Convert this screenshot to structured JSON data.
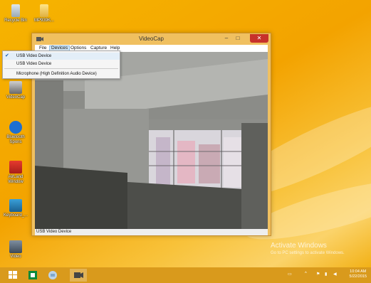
{
  "desktop": {
    "icons": [
      {
        "label": "Recycle Bin"
      },
      {
        "label": "MP939K..."
      },
      {
        "label": "VideoCap"
      },
      {
        "label": "Bluetooth Spons"
      },
      {
        "label": "AirLand Window"
      },
      {
        "label": "Keyboard_..."
      },
      {
        "label": "Video"
      }
    ]
  },
  "window": {
    "title": "VideoCap",
    "controls": {
      "minimize": "–",
      "maximize": "□",
      "close": "✕"
    },
    "menu": [
      "File",
      "Devices",
      "Options",
      "Capture",
      "Help"
    ],
    "status": "USB Video Device"
  },
  "dropdown": {
    "items": [
      {
        "label": "USB Video Device",
        "checked": true
      },
      {
        "label": "USB Video Device",
        "checked": false
      },
      {
        "label": "Microphone (High Definition Audio Device)",
        "checked": false
      }
    ],
    "check_glyph": "✔"
  },
  "watermark": {
    "title": "Activate Windows",
    "subtitle": "Go to PC settings to activate Windows."
  },
  "taskbar": {
    "clock_time": "10:04 AM",
    "clock_date": "5/22/2015"
  }
}
